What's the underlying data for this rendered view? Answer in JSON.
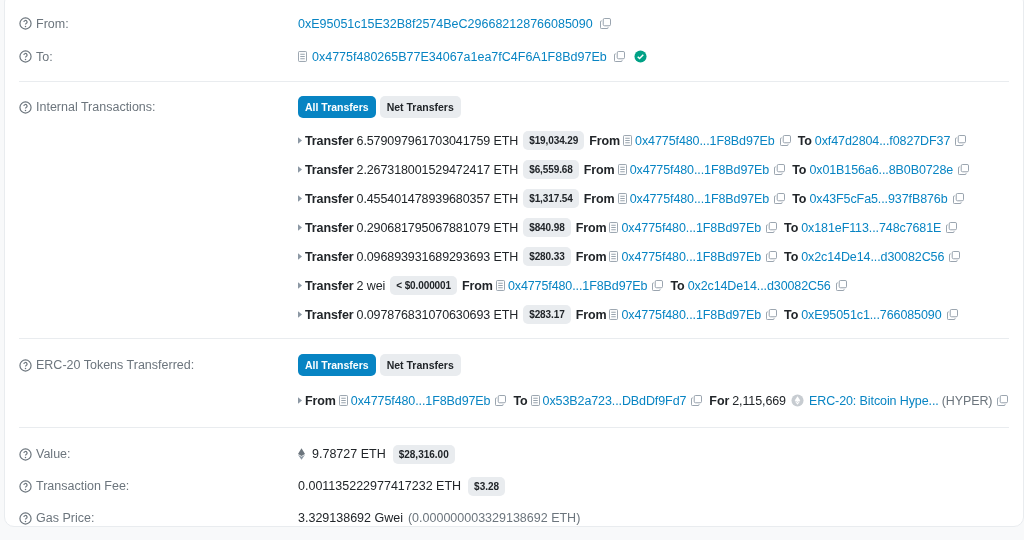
{
  "from": {
    "label": "From:",
    "address": "0xE95051c15E32B8f2574BeC296682128766085090"
  },
  "to": {
    "label": "To:",
    "address": "0x4775f480265B77E34067a1ea7fC4F6A1F8Bd97Eb",
    "verified": true
  },
  "internal_transactions": {
    "label": "Internal Transactions:",
    "tabs": [
      {
        "label": "All Transfers",
        "selected": true
      },
      {
        "label": "Net Transfers",
        "selected": false
      }
    ],
    "transfers": [
      {
        "label": "Transfer",
        "amount": "6.579097961703041759 ETH",
        "usd": "$19,034.29",
        "from_label": "From",
        "from": "0x4775f480...1F8Bd97Eb",
        "from_contract": true,
        "to_label": "To",
        "to": "0xf47d2804...f0827DF37",
        "to_contract": false
      },
      {
        "label": "Transfer",
        "amount": "2.267318001529472417 ETH",
        "usd": "$6,559.68",
        "from_label": "From",
        "from": "0x4775f480...1F8Bd97Eb",
        "from_contract": true,
        "to_label": "To",
        "to": "0x01B156a6...8B0B0728e",
        "to_contract": false
      },
      {
        "label": "Transfer",
        "amount": "0.455401478939680357 ETH",
        "usd": "$1,317.54",
        "from_label": "From",
        "from": "0x4775f480...1F8Bd97Eb",
        "from_contract": true,
        "to_label": "To",
        "to": "0x43F5cFa5...937fB876b",
        "to_contract": false
      },
      {
        "label": "Transfer",
        "amount": "0.290681795067881079 ETH",
        "usd": "$840.98",
        "from_label": "From",
        "from": "0x4775f480...1F8Bd97Eb",
        "from_contract": true,
        "to_label": "To",
        "to": "0x181eF113...748c7681E",
        "to_contract": false
      },
      {
        "label": "Transfer",
        "amount": "0.096893931689293693 ETH",
        "usd": "$280.33",
        "from_label": "From",
        "from": "0x4775f480...1F8Bd97Eb",
        "from_contract": true,
        "to_label": "To",
        "to": "0x2c14De14...d30082C56",
        "to_contract": false
      },
      {
        "label": "Transfer",
        "amount": "2 wei",
        "usd": "< $0.000001",
        "from_label": "From",
        "from": "0x4775f480...1F8Bd97Eb",
        "from_contract": true,
        "to_label": "To",
        "to": "0x2c14De14...d30082C56",
        "to_contract": false
      },
      {
        "label": "Transfer",
        "amount": "0.097876831070630693 ETH",
        "usd": "$283.17",
        "from_label": "From",
        "from": "0x4775f480...1F8Bd97Eb",
        "from_contract": true,
        "to_label": "To",
        "to": "0xE95051c1...766085090",
        "to_contract": false
      }
    ]
  },
  "erc20_tokens": {
    "label": "ERC-20 Tokens Transferred:",
    "tabs": [
      {
        "label": "All Transfers",
        "selected": true
      },
      {
        "label": "Net Transfers",
        "selected": false
      }
    ],
    "transfers": [
      {
        "from_label": "From",
        "from": "0x4775f480...1F8Bd97Eb",
        "from_contract": true,
        "to_label": "To",
        "to": "0x53B2a723...DBdDf9Fd7",
        "to_contract": true,
        "for_label": "For",
        "quantity": "2,115,669",
        "token": "ERC-20: Bitcoin Hype...",
        "symbol": "(HYPER)"
      }
    ]
  },
  "value": {
    "label": "Value:",
    "amount": "9.78727 ETH",
    "usd": "$28,316.00"
  },
  "transaction_fee": {
    "label": "Transaction Fee:",
    "amount": "0.001135222977417232 ETH",
    "usd": "$3.28"
  },
  "gas_price": {
    "label": "Gas Price:",
    "amount": "3.329138692 Gwei",
    "detail": "(0.000000003329138692 ETH)"
  }
}
